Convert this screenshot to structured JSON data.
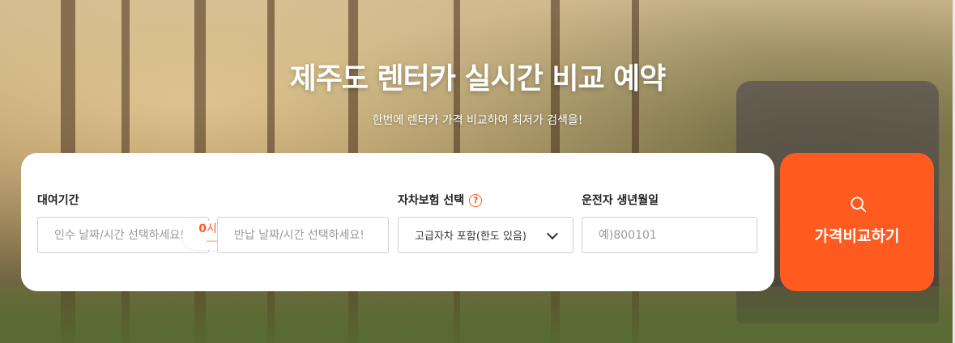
{
  "hero": {
    "title": "제주도 렌터카 실시간 비교 예약",
    "subtitle": "한번에 렌터카 가격 비교하여 최저가 검색을!"
  },
  "search_form": {
    "rental_period": {
      "label": "대여기간",
      "pickup_placeholder": "인수 날짜/시간 선택하세요!",
      "return_placeholder": "반납 날짜/시간 선택하세요!",
      "duration_value": "0",
      "duration_unit": "시간"
    },
    "insurance": {
      "label": "자차보험 선택",
      "help_symbol": "?",
      "selected": "고급자차 포함(한도 있음)"
    },
    "driver_birth": {
      "label": "운전자 생년월일",
      "placeholder": "예)800101"
    },
    "submit_label": "가격비교하기"
  },
  "colors": {
    "accent": "#ff5a1f",
    "card_bg": "#ffffff"
  },
  "icons": {
    "help": "help-circle-icon",
    "dropdown": "chevron-down-icon",
    "search": "search-icon",
    "arrow": "arrow-right-icon"
  }
}
